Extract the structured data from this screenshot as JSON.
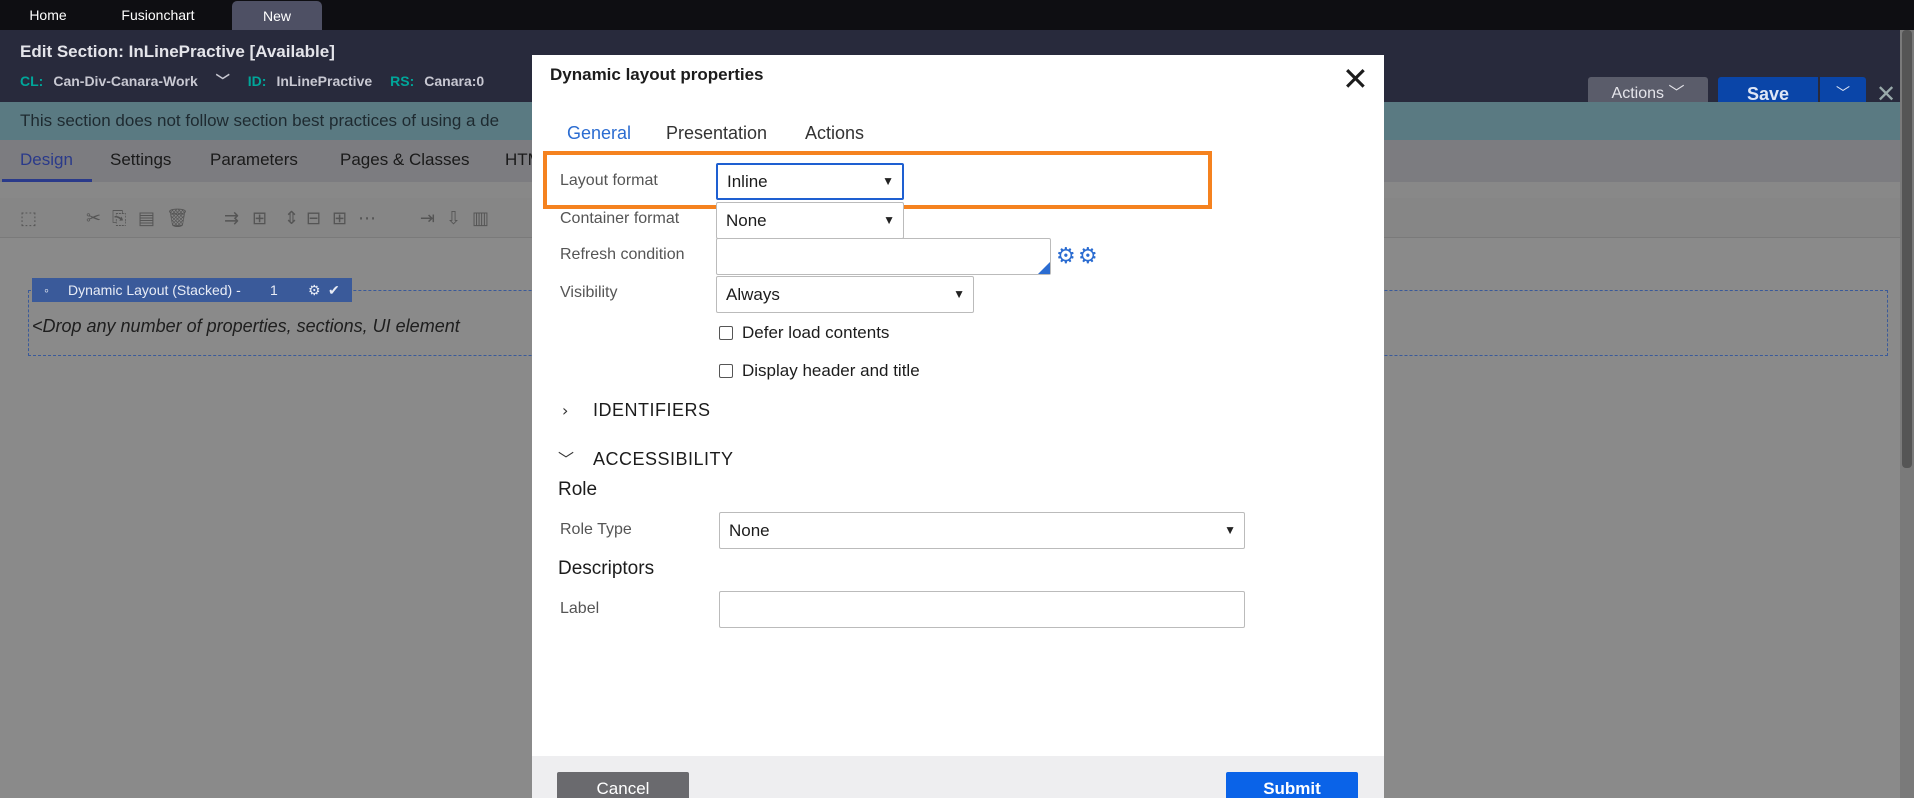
{
  "top_tabs": [
    {
      "label": "Home"
    },
    {
      "label": "Fusionchart"
    },
    {
      "label": "New"
    }
  ],
  "header": {
    "title": "Edit  Section: InLinePractive [Available]",
    "cl_key": "CL:",
    "cl_value": "Can-Div-Canara-Work",
    "id_key": "ID:",
    "id_value": "InLinePractive",
    "rs_key": "RS:",
    "rs_value": "Canara:0",
    "actions_label": "Actions",
    "save_label": "Save"
  },
  "banner": {
    "text": "This section does not follow section best practices of using a de"
  },
  "subtabs": [
    {
      "label": "Design"
    },
    {
      "label": "Settings"
    },
    {
      "label": "Parameters"
    },
    {
      "label": "Pages & Classes"
    },
    {
      "label": "HTM"
    }
  ],
  "canvas": {
    "layout_label": "Dynamic Layout (Stacked) -",
    "layout_index": "1",
    "drop_hint": "<Drop any number of properties, sections, UI element"
  },
  "modal": {
    "title": "Dynamic layout properties",
    "tabs": [
      {
        "label": "General"
      },
      {
        "label": "Presentation"
      },
      {
        "label": "Actions"
      }
    ],
    "fields": {
      "layout_format": {
        "label": "Layout format",
        "value": "Inline"
      },
      "container_format": {
        "label": "Container format",
        "value": "None"
      },
      "refresh_condition": {
        "label": "Refresh condition",
        "value": ""
      },
      "visibility": {
        "label": "Visibility",
        "value": "Always"
      }
    },
    "checkboxes": {
      "defer_load": {
        "label": "Defer load contents",
        "checked": false
      },
      "display_header": {
        "label": "Display header and title",
        "checked": false
      }
    },
    "sections": {
      "identifiers": "IDENTIFIERS",
      "accessibility": "ACCESSIBILITY"
    },
    "accessibility": {
      "role_heading": "Role",
      "role_type_label": "Role Type",
      "role_type_value": "None",
      "descriptors_heading": "Descriptors",
      "label_label": "Label",
      "label_value": ""
    },
    "buttons": {
      "cancel": "Cancel",
      "submit": "Submit"
    }
  },
  "colors": {
    "accent": "#2b6cd1",
    "highlight": "#f5821f",
    "submit": "#0a63e8"
  }
}
